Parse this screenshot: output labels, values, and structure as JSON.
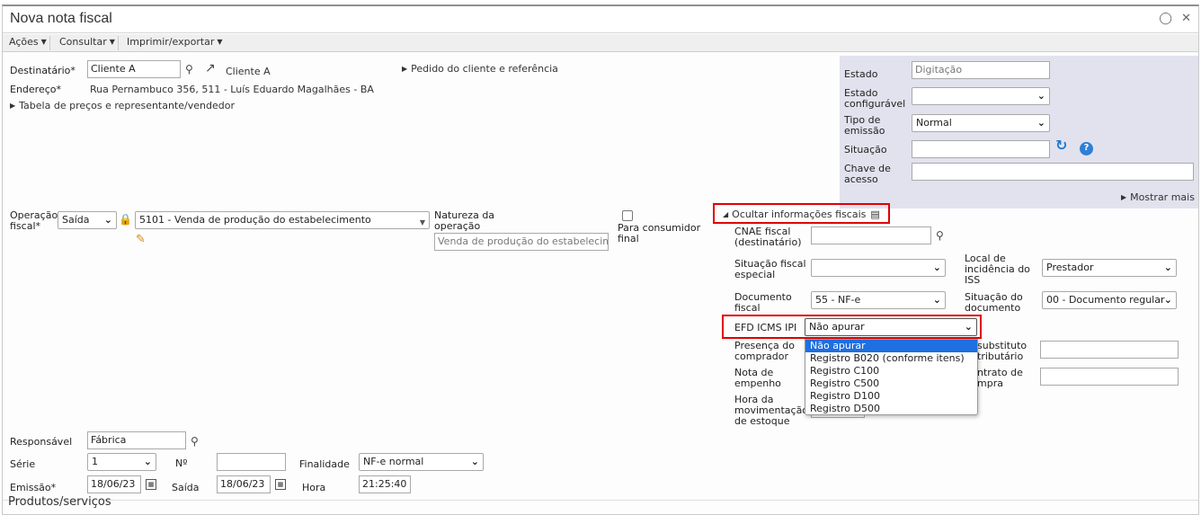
{
  "window": {
    "title": "Nova nota fiscal",
    "icons": [
      "comment-icon",
      "close-icon"
    ]
  },
  "menu": {
    "acoes": "Ações",
    "consultar": "Consultar",
    "imprimir": "Imprimir/exportar"
  },
  "destinatario": {
    "label": "Destinatário*",
    "value": "Cliente A",
    "link_text": "Cliente A",
    "endereco_label": "Endereço*",
    "endereco_value": "Rua Pernambuco 356, 511 - Luís Eduardo Magalhães - BA",
    "tabela_link": "Tabela de preços e representante/vendedor",
    "pedido_link": "Pedido do cliente e referência"
  },
  "status_panel": {
    "estado_label": "Estado",
    "estado_value": "Digitação",
    "estado_config_label": "Estado configurável",
    "estado_config_value": "",
    "tipo_emissao_label": "Tipo de emissão",
    "tipo_emissao_value": "Normal",
    "situacao_label": "Situação",
    "situacao_value": "",
    "chave_label": "Chave de acesso",
    "chave_value": "",
    "mostrar_mais": "Mostrar mais"
  },
  "operacao": {
    "label": "Operação fiscal*",
    "tipo_value": "Saída",
    "cfop_value": "5101 - Venda de produção do estabelecimento",
    "natureza_label": "Natureza da operação",
    "natureza_value": "Venda de produção do estabelecime",
    "consumidor_label": "Para consumidor final"
  },
  "fiscal_info": {
    "toggle_label": "Ocultar informações fiscais",
    "cnae_label": "CNAE fiscal (destinatário)",
    "cnae_value": "",
    "sit_especial_label": "Situação fiscal especial",
    "sit_especial_value": "",
    "local_iss_label": "Local de incidência do ISS",
    "local_iss_value": "Prestador",
    "documento_label": "Documento fiscal",
    "documento_value": "55 - NF-e",
    "sit_documento_label": "Situação do documento",
    "sit_documento_value": "00 - Documento regular",
    "efd_label": "EFD ICMS IPI",
    "efd_value": "Não apurar",
    "efd_options": [
      "Não apurar",
      "Registro B020 (conforme itens)",
      "Registro C100",
      "Registro C500",
      "Registro D100",
      "Registro D500"
    ],
    "presenca_label": "Presença do comprador",
    "substituto_label": "substituto\ntributário",
    "substituto_value": "",
    "empenho_label": "Nota de empenho",
    "contrato_label": "ntrato de\nmpra",
    "contrato_value": "",
    "hora_mov_label": "Hora da movimentação de estoque"
  },
  "bottom": {
    "responsavel_label": "Responsável",
    "responsavel_value": "Fábrica",
    "serie_label": "Série",
    "serie_value": "1",
    "numero_label": "Nº",
    "numero_value": "",
    "finalidade_label": "Finalidade",
    "finalidade_value": "NF-e normal",
    "emissao_label": "Emissão*",
    "emissao_value": "18/06/23",
    "saida_label": "Saída",
    "saida_value": "18/06/23",
    "hora_label": "Hora",
    "hora_value": "21:25:40",
    "produtos_label": "Produtos/serviços"
  },
  "colors": {
    "highlight_red": "#e00000",
    "panel_bg": "#e2e2ee",
    "selected_option": "#1e6fe0"
  }
}
